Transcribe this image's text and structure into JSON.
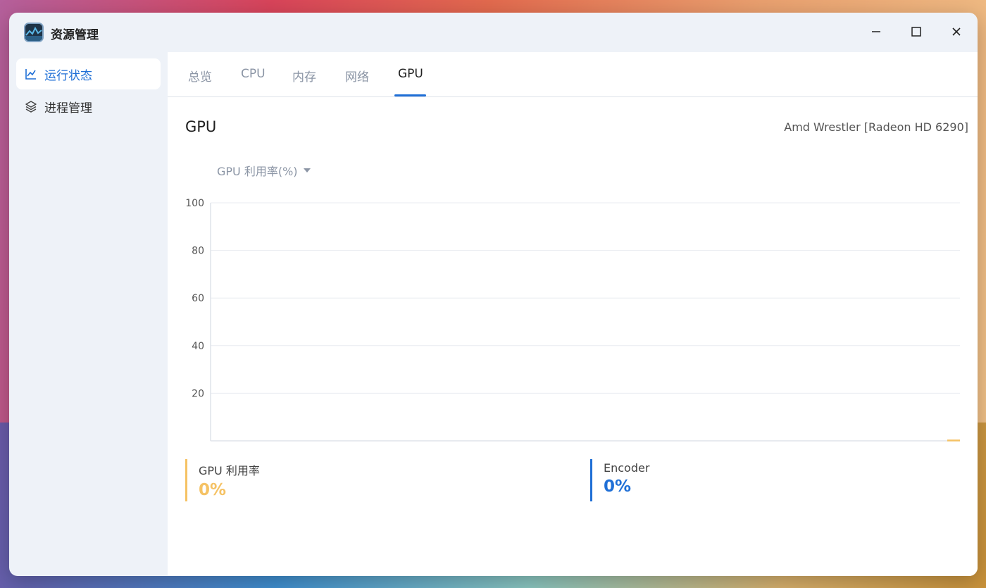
{
  "app": {
    "title": "资源管理"
  },
  "sidebar": {
    "items": [
      {
        "label": "运行状态",
        "icon": "chart-line-icon",
        "active": true
      },
      {
        "label": "进程管理",
        "icon": "layers-icon",
        "active": false
      }
    ]
  },
  "tabs": [
    {
      "label": "总览"
    },
    {
      "label": "CPU"
    },
    {
      "label": "内存"
    },
    {
      "label": "网络"
    },
    {
      "label": "GPU",
      "active": true
    }
  ],
  "gpu": {
    "heading": "GPU",
    "name": "Amd Wrestler [Radeon HD 6290]",
    "metric_select": "GPU 利用率(%)"
  },
  "chart_data": {
    "type": "line",
    "y_ticks": [
      "100",
      "80",
      "60",
      "40",
      "20"
    ],
    "ylim": [
      0,
      100
    ],
    "grid": true,
    "series": [
      {
        "name": "GPU 利用率",
        "color": "#f5c264",
        "values": [
          0
        ]
      }
    ]
  },
  "stats": [
    {
      "label": "GPU 利用率",
      "value": "0%",
      "color": "#f5c264"
    },
    {
      "label": "Encoder",
      "value": "0%",
      "color": "#1f6fd6"
    }
  ]
}
